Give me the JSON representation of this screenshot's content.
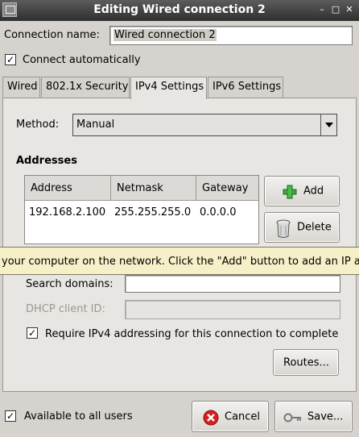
{
  "window": {
    "title": "Editing Wired connection 2",
    "controls": [
      "minimize",
      "maximize",
      "close"
    ]
  },
  "connection_name": {
    "label": "Connection name:",
    "value": "Wired connection 2"
  },
  "connect_automatically": {
    "label": "Connect automatically",
    "checked": true
  },
  "tabs": [
    {
      "label": "Wired",
      "active": false
    },
    {
      "label": "802.1x Security",
      "active": false
    },
    {
      "label": "IPv4 Settings",
      "active": true
    },
    {
      "label": "IPv6 Settings",
      "active": false
    }
  ],
  "ipv4": {
    "method_label": "Method:",
    "method_value": "Manual",
    "addresses_heading": "Addresses",
    "columns": [
      "Address",
      "Netmask",
      "Gateway"
    ],
    "rows": [
      {
        "address": "192.168.2.100",
        "netmask": "255.255.255.0",
        "gateway": "0.0.0.0"
      }
    ],
    "add_button": "Add",
    "delete_button": "Delete",
    "search_domains_label": "Search domains:",
    "search_domains_value": "",
    "dhcp_client_id_label": "DHCP client ID:",
    "dhcp_client_id_value": "",
    "require_ipv4": {
      "label": "Require IPv4 addressing for this connection to complete",
      "checked": true
    },
    "routes_button": "Routes..."
  },
  "tooltip": {
    "text": "your computer on the network.  Click the \"Add\" button to add an IP ad"
  },
  "footer": {
    "available_all_users": {
      "label": "Available to all users",
      "checked": true
    },
    "cancel_button": "Cancel",
    "save_button": "Save..."
  },
  "colors": {
    "window_bg": "#d6d3ce",
    "tooltip_bg": "#f5f0c8",
    "titlebar_bg": "#3a3a3a",
    "add_icon": "#3aa53a",
    "cancel_icon": "#d42020"
  },
  "icons": [
    "app-icon",
    "minimize-icon",
    "maximize-icon",
    "close-icon",
    "add-icon",
    "trash-icon",
    "cancel-icon",
    "key-icon",
    "dropdown-arrow-icon",
    "checkmark-icon"
  ]
}
